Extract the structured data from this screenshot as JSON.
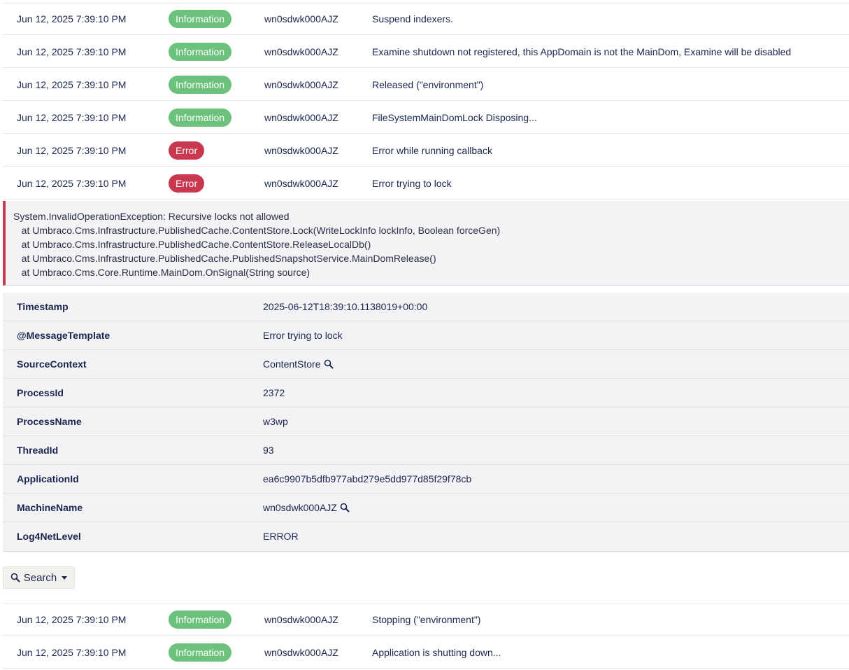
{
  "rows_top": [
    {
      "timestamp": "Jun 12, 2025 7:39:10 PM",
      "level": "Information",
      "level_type": "info",
      "machine": "wn0sdwk000AJZ",
      "message": "Suspend indexers."
    },
    {
      "timestamp": "Jun 12, 2025 7:39:10 PM",
      "level": "Information",
      "level_type": "info",
      "machine": "wn0sdwk000AJZ",
      "message": "Examine shutdown not registered, this AppDomain is not the MainDom, Examine will be disabled"
    },
    {
      "timestamp": "Jun 12, 2025 7:39:10 PM",
      "level": "Information",
      "level_type": "info",
      "machine": "wn0sdwk000AJZ",
      "message": "Released (\"environment\")"
    },
    {
      "timestamp": "Jun 12, 2025 7:39:10 PM",
      "level": "Information",
      "level_type": "info",
      "machine": "wn0sdwk000AJZ",
      "message": "FileSystemMainDomLock Disposing..."
    },
    {
      "timestamp": "Jun 12, 2025 7:39:10 PM",
      "level": "Error",
      "level_type": "error",
      "machine": "wn0sdwk000AJZ",
      "message": "Error while running callback"
    },
    {
      "timestamp": "Jun 12, 2025 7:39:10 PM",
      "level": "Error",
      "level_type": "error",
      "machine": "wn0sdwk000AJZ",
      "message": "Error trying to lock"
    }
  ],
  "exception": {
    "lines": [
      "System.InvalidOperationException: Recursive locks not allowed",
      "   at Umbraco.Cms.Infrastructure.PublishedCache.ContentStore.Lock(WriteLockInfo lockInfo, Boolean forceGen)",
      "   at Umbraco.Cms.Infrastructure.PublishedCache.ContentStore.ReleaseLocalDb()",
      "   at Umbraco.Cms.Infrastructure.PublishedCache.PublishedSnapshotService.MainDomRelease()",
      "   at Umbraco.Cms.Core.Runtime.MainDom.OnSignal(String source)"
    ]
  },
  "properties": [
    {
      "key": "Timestamp",
      "value": "2025-06-12T18:39:10.1138019+00:00",
      "searchable": false
    },
    {
      "key": "@MessageTemplate",
      "value": "Error trying to lock",
      "searchable": false
    },
    {
      "key": "SourceContext",
      "value": "ContentStore",
      "searchable": true
    },
    {
      "key": "ProcessId",
      "value": "2372",
      "searchable": false
    },
    {
      "key": "ProcessName",
      "value": "w3wp",
      "searchable": false
    },
    {
      "key": "ThreadId",
      "value": "93",
      "searchable": false
    },
    {
      "key": "ApplicationId",
      "value": "ea6c9907b5dfb977abd279e5dd977d85f29f78cb",
      "searchable": false
    },
    {
      "key": "MachineName",
      "value": "wn0sdwk000AJZ",
      "searchable": true
    },
    {
      "key": "Log4NetLevel",
      "value": "ERROR",
      "searchable": false
    }
  ],
  "search_button": {
    "label": "Search"
  },
  "rows_bottom": [
    {
      "timestamp": "Jun 12, 2025 7:39:10 PM",
      "level": "Information",
      "level_type": "info",
      "machine": "wn0sdwk000AJZ",
      "message": "Stopping (\"environment\")"
    },
    {
      "timestamp": "Jun 12, 2025 7:39:10 PM",
      "level": "Information",
      "level_type": "info",
      "machine": "wn0sdwk000AJZ",
      "message": "Application is shutting down..."
    }
  ],
  "colors": {
    "info": "#6cc17c",
    "error": "#c8384f",
    "text": "#1b264f"
  },
  "icons": {
    "search": "magnifier-icon",
    "dropdown": "caret-down-icon"
  }
}
